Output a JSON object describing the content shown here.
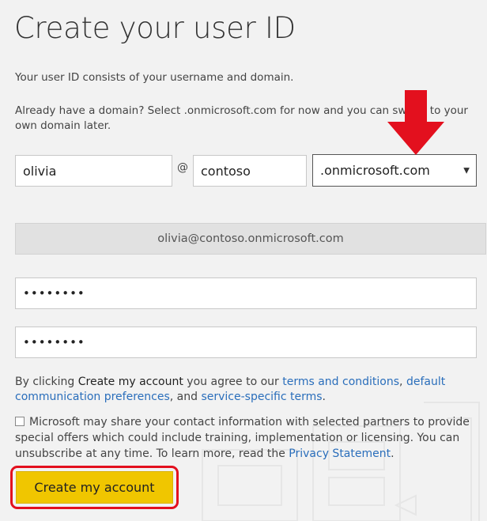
{
  "page": {
    "title": "Create your user ID",
    "intro": "Your user ID consists of your username and domain.",
    "domain_hint": "Already have a domain? Select .onmicrosoft.com for now and you can switch to your own domain later."
  },
  "form": {
    "username_value": "olivia",
    "at_sign": "@",
    "domain_value": "contoso",
    "suffix_selected": ".onmicrosoft.com",
    "suffix_arrow": "▼",
    "preview_value": "olivia@contoso.onmicrosoft.com",
    "password_mask": "••••••••",
    "confirm_password_mask": "••••••••"
  },
  "agreement": {
    "prefix": "By clicking ",
    "button_ref": "Create my account",
    "middle": " you agree to our ",
    "terms_link": "terms and conditions",
    "comma": ", ",
    "comm_link": "default communication preferences",
    "and": ", and ",
    "service_link": "service-specific terms",
    "end": "."
  },
  "consent": {
    "text": "Microsoft may share your contact information with selected partners to provide special offers which could include training, implementation or licensing. You can unsubscribe at any time. To learn more, read the ",
    "privacy_link": "Privacy Statement",
    "end": "."
  },
  "actions": {
    "create_label": "Create my account"
  },
  "icons": {
    "annotation_arrow": "down-arrow-icon",
    "annotation_color": "#e3101e",
    "button_color": "#f0c600"
  }
}
